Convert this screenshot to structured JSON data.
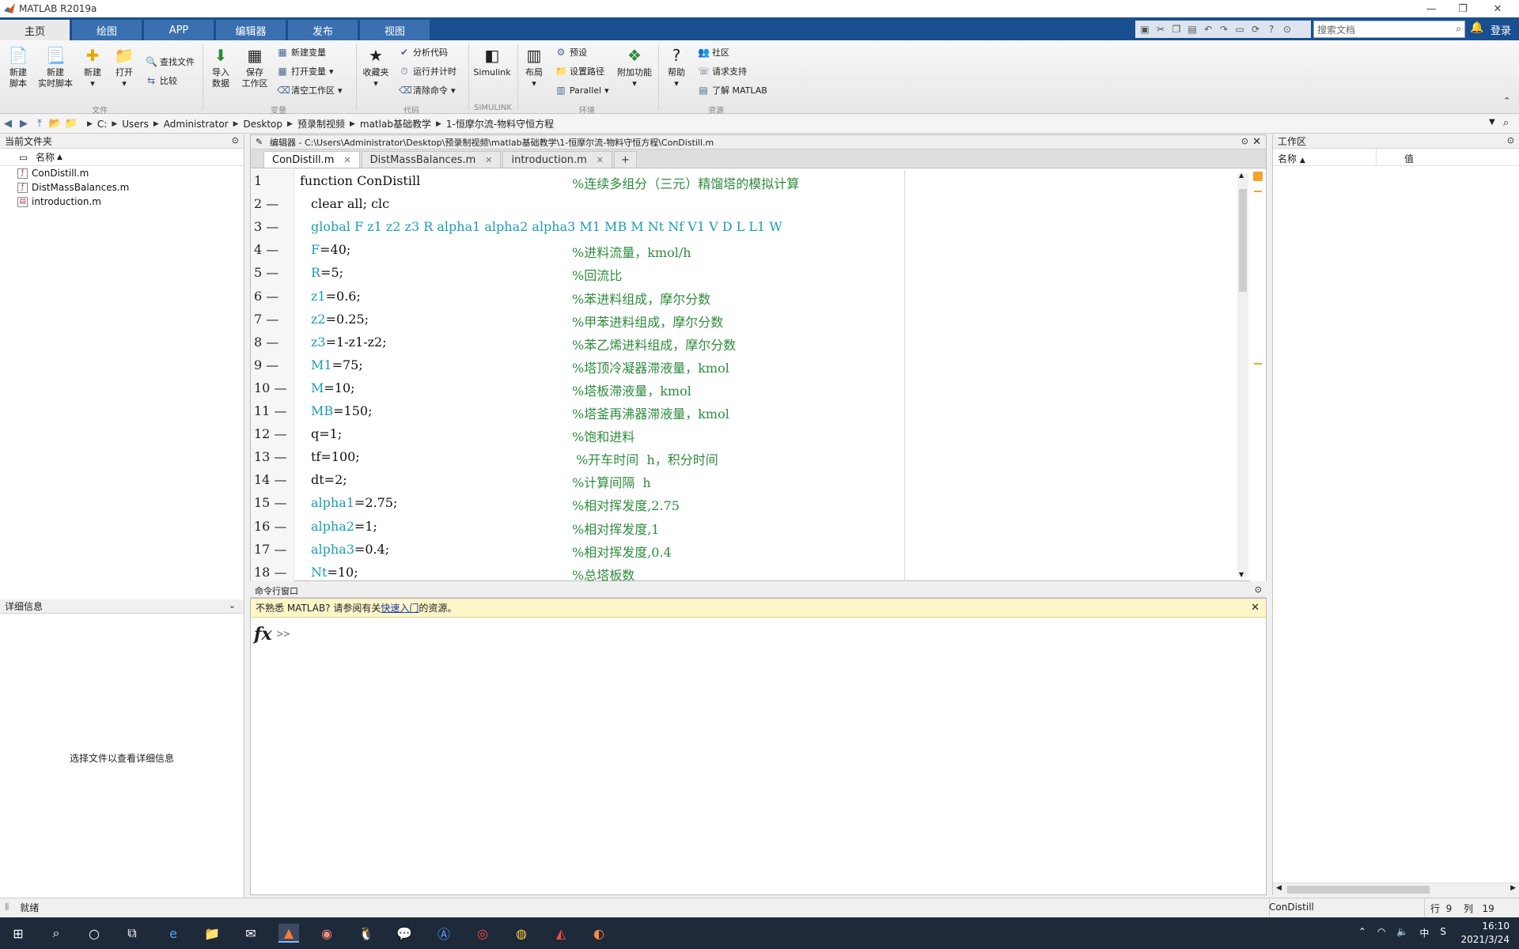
{
  "window": {
    "title": "MATLAB R2019a"
  },
  "ribbon_tabs": [
    "主页",
    "绘图",
    "APP",
    "编辑器",
    "发布",
    "视图"
  ],
  "search_doc_placeholder": "搜索文档",
  "login_label": "登录",
  "ribbon": {
    "file": {
      "new_script": [
        "新建",
        "脚本"
      ],
      "new_live": [
        "新建",
        "实时脚本"
      ],
      "new": "新建",
      "open": "打开",
      "find_files": "查找文件",
      "compare": "比较",
      "group": "文件"
    },
    "variable": {
      "import": [
        "导入",
        "数据"
      ],
      "save": [
        "保存",
        "工作区"
      ],
      "new_var": "新建变量",
      "open_var": "打开变量",
      "clear_ws": "清空工作区",
      "group": "变量"
    },
    "code": {
      "favorites": "收藏夹",
      "analyze": "分析代码",
      "run_time": "运行并计时",
      "clear_cmd": "清除命令",
      "group": "代码"
    },
    "simulink": {
      "simulink": "Simulink",
      "group": "SIMULINK"
    },
    "env": {
      "layout": "布局",
      "prefs": "预设",
      "set_path": "设置路径",
      "parallel": "Parallel",
      "addons": "附加功能",
      "group": "环境"
    },
    "resources": {
      "help": "帮助",
      "community": "社区",
      "request_support": "请求支持",
      "learn": "了解 MATLAB",
      "group": "资源"
    }
  },
  "address": {
    "parts": [
      "C:",
      "Users",
      "Administrator",
      "Desktop",
      "预录制视频",
      "matlab基础教学",
      "1-恒摩尔流-物料守恒方程"
    ]
  },
  "current_folder": {
    "title": "当前文件夹",
    "col_name": "名称",
    "files": [
      "ConDistill.m",
      "DistMassBalances.m",
      "introduction.m"
    ],
    "details_title": "详细信息",
    "details_msg": "选择文件以查看详细信息"
  },
  "editor": {
    "header": "编辑器 - C:\\Users\\Administrator\\Desktop\\预录制视频\\matlab基础教学\\1-恒摩尔流-物料守恒方程\\ConDistill.m",
    "tabs": [
      "ConDistill.m",
      "DistMassBalances.m",
      "introduction.m"
    ],
    "lines": [
      {
        "n": "1",
        "code": "function ConDistill",
        "comment": "%连续多组分（三元）精馏塔的模拟计算"
      },
      {
        "n": "2 —",
        "code": "clear all; clc",
        "comment": ""
      },
      {
        "n": "3 —",
        "code": "global F z1 z2 z3 R alpha1 alpha2 alpha3 M1 MB M Nt Nf V1 V D L L1 W",
        "comment": ""
      },
      {
        "n": "4 —",
        "code": "F=40;",
        "comment": "%进料流量，kmol/h"
      },
      {
        "n": "5 —",
        "code": "R=5;",
        "comment": "%回流比"
      },
      {
        "n": "6 —",
        "code": "z1=0.6;",
        "comment": "%苯进料组成，摩尔分数"
      },
      {
        "n": "7 —",
        "code": "z2=0.25;",
        "comment": "%甲苯进料组成，摩尔分数"
      },
      {
        "n": "8 —",
        "code": "z3=1-z1-z2;",
        "comment": "%苯乙烯进料组成，摩尔分数"
      },
      {
        "n": "9 —",
        "code": "M1=75;",
        "comment": "%塔顶冷凝器滞液量，kmol"
      },
      {
        "n": "10 —",
        "code": "M=10;",
        "comment": "%塔板滞液量，kmol"
      },
      {
        "n": "11 —",
        "code": "MB=150;",
        "comment": "%塔釜再沸器滞液量，kmol"
      },
      {
        "n": "12 —",
        "code": "q=1;",
        "comment": "%饱和进料"
      },
      {
        "n": "13 —",
        "code": "tf=100;",
        "comment": " %开车时间  h，积分时间"
      },
      {
        "n": "14 —",
        "code": "dt=2;",
        "comment": "%计算间隔  h"
      },
      {
        "n": "15 —",
        "code": "alpha1=2.75;",
        "comment": "%相对挥发度,2.75"
      },
      {
        "n": "16 —",
        "code": "alpha2=1;",
        "comment": "%相对挥发度,1"
      },
      {
        "n": "17 —",
        "code": "alpha3=0.4;",
        "comment": "%相对挥发度,0.4"
      },
      {
        "n": "18 —",
        "code": "Nt=10;",
        "comment": "%总塔板数"
      }
    ]
  },
  "command_window": {
    "title": "命令行窗口",
    "tip_prefix": "不熟悉 MATLAB? 请参阅有关",
    "tip_link": "快速入门",
    "tip_suffix": "的资源。",
    "fx": "fx",
    "prompt": ">>"
  },
  "workspace": {
    "title": "工作区",
    "col_name": "名称",
    "col_value": "值"
  },
  "status": {
    "text": "就绪",
    "file": "ConDistill",
    "row_label": "行",
    "row": "9",
    "col_label": "列",
    "col": "19"
  },
  "taskbar": {
    "time": "16:10",
    "date": "2021/3/24",
    "ime": "中"
  }
}
